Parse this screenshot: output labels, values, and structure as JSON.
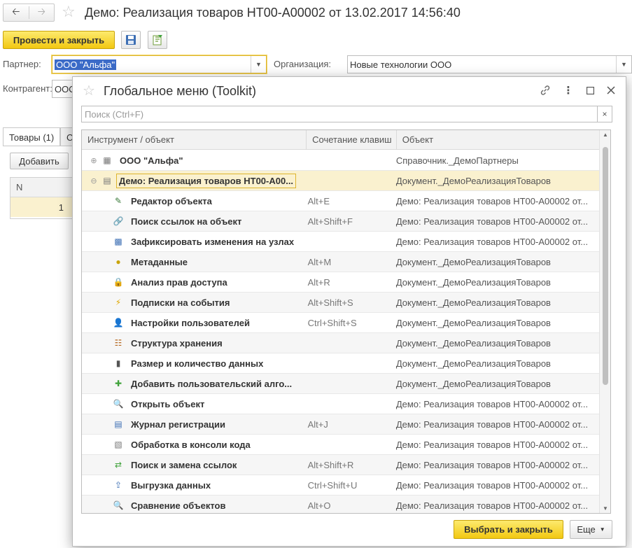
{
  "window": {
    "title": "Демо: Реализация товаров НТ00-А00002 от 13.02.2017 14:56:40"
  },
  "toolbar": {
    "post_close_label": "Провести и закрыть"
  },
  "form": {
    "partner_label": "Партнер:",
    "partner_value": "ООО \"Альфа\"",
    "org_label": "Организация:",
    "org_value": "Новые технологии ООО",
    "contractor_label": "Контрагент:",
    "contractor_value": "ООО",
    "tabs": [
      {
        "label": "Товары (1)"
      },
      {
        "label": "С"
      }
    ],
    "add_button": "Добавить",
    "table_header_n": "N",
    "table_row_n": "1"
  },
  "dialog": {
    "title": "Глобальное меню (Toolkit)",
    "search_placeholder": "Поиск (Ctrl+F)",
    "columns": [
      "Инструмент / объект",
      "Сочетание клавиш",
      "Объект"
    ],
    "rows": [
      {
        "name": "ООО \"Альфа\"",
        "shortcut": "",
        "object": "Справочник._ДемоПартнеры",
        "icon": "catalog-icon",
        "level": 0
      },
      {
        "name": "Демо: Реализация товаров НТ00-А00...",
        "shortcut": "",
        "object": "Документ._ДемоРеализацияТоваров",
        "icon": "document-icon",
        "level": 0
      },
      {
        "name": "Редактор объекта",
        "shortcut": "Alt+E",
        "object": "Демо: Реализация товаров НТ00-А00002 от...",
        "icon": "editor-icon",
        "level": 1
      },
      {
        "name": "Поиск ссылок на объект",
        "shortcut": "Alt+Shift+F",
        "object": "Демо: Реализация товаров НТ00-А00002 от...",
        "icon": "find-links-icon",
        "level": 1
      },
      {
        "name": "Зафиксировать изменения на узлах",
        "shortcut": "",
        "object": "Демо: Реализация товаров НТ00-А00002 от...",
        "icon": "nodes-icon",
        "level": 1
      },
      {
        "name": "Метаданные",
        "shortcut": "Alt+M",
        "object": "Документ._ДемоРеализацияТоваров",
        "icon": "metadata-icon",
        "level": 1
      },
      {
        "name": "Анализ прав доступа",
        "shortcut": "Alt+R",
        "object": "Документ._ДемоРеализацияТоваров",
        "icon": "lock-icon",
        "level": 1
      },
      {
        "name": "Подписки на события",
        "shortcut": "Alt+Shift+S",
        "object": "Документ._ДемоРеализацияТоваров",
        "icon": "subscription-icon",
        "level": 1
      },
      {
        "name": "Настройки пользователей",
        "shortcut": "Ctrl+Shift+S",
        "object": "Документ._ДемоРеализацияТоваров",
        "icon": "user-settings-icon",
        "level": 1
      },
      {
        "name": "Структура хранения",
        "shortcut": "",
        "object": "Документ._ДемоРеализацияТоваров",
        "icon": "storage-icon",
        "level": 1
      },
      {
        "name": "Размер и количество данных",
        "shortcut": "",
        "object": "Документ._ДемоРеализацияТоваров",
        "icon": "bar-chart-icon",
        "level": 1
      },
      {
        "name": "Добавить пользовательский алго...",
        "shortcut": "",
        "object": "Документ._ДемоРеализацияТоваров",
        "icon": "add-algorithm-icon",
        "level": 1
      },
      {
        "name": "Открыть объект",
        "shortcut": "",
        "object": "Демо: Реализация товаров НТ00-А00002 от...",
        "icon": "search-icon",
        "level": 1
      },
      {
        "name": "Журнал регистрации",
        "shortcut": "Alt+J",
        "object": "Демо: Реализация товаров НТ00-А00002 от...",
        "icon": "journal-icon",
        "level": 1
      },
      {
        "name": "Обработка в консоли кода",
        "shortcut": "",
        "object": "Демо: Реализация товаров НТ00-А00002 от...",
        "icon": "console-icon",
        "level": 1
      },
      {
        "name": "Поиск и замена ссылок",
        "shortcut": "Alt+Shift+R",
        "object": "Демо: Реализация товаров НТ00-А00002 от...",
        "icon": "replace-links-icon",
        "level": 1
      },
      {
        "name": "Выгрузка данных",
        "shortcut": "Ctrl+Shift+U",
        "object": "Демо: Реализация товаров НТ00-А00002 от...",
        "icon": "export-icon",
        "level": 1
      },
      {
        "name": "Сравнение объектов",
        "shortcut": "Alt+O",
        "object": "Демо: Реализация товаров НТ00-А00002 от...",
        "icon": "compare-icon",
        "level": 1
      }
    ],
    "select_close_label": "Выбрать и закрыть",
    "more_label": "Еще"
  },
  "colors": {
    "accent_yellow": "#f2c811",
    "selection_blue": "#3b6bc8",
    "selected_row": "#faf1cf"
  }
}
